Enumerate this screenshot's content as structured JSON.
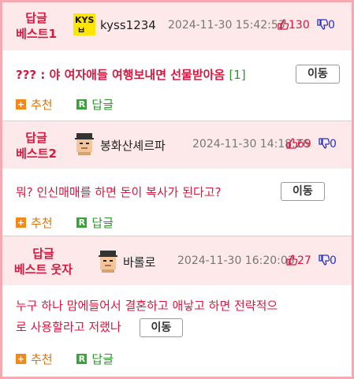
{
  "posts": [
    {
      "badge_line1": "답글",
      "badge_line2": "베스트1",
      "nickname": "kyss1234",
      "avatar_icon": "kys-logo-avatar",
      "datetime": "2024-11-30 15:42:53",
      "likes": "130",
      "dislikes": "0",
      "body": "??? : 야 여자애들 여행보내면 선물받아옴",
      "reply_count": "[1]",
      "move_label": "이동",
      "recommend_label": "추천",
      "reply_label": "답글"
    },
    {
      "badge_line1": "답글",
      "badge_line2": "베스트2",
      "nickname": "봉화산셰르파",
      "avatar_icon": "pixel-face-avatar",
      "datetime": "2024-11-30 14:18:26",
      "likes": "69",
      "dislikes": "0",
      "body": "뭐? 인신매매를 하면 돈이 복사가 된다고?",
      "move_label": "이동",
      "recommend_label": "추천",
      "reply_label": "답글"
    },
    {
      "badge_line1": "답글",
      "badge_line2": "베스트 웃자",
      "nickname": "바롤로",
      "avatar_icon": "pixel-face-avatar",
      "datetime": "2024-11-30 16:20:03",
      "likes": "27",
      "dislikes": "0",
      "body_line1": "누구 하나 맘에들어서 결혼하고 애낳고 하면 전략적으",
      "body_line2": "로 사용할라고 저랬나",
      "move_label": "이동",
      "recommend_label": "추천",
      "reply_label": "답글"
    }
  ],
  "colors": {
    "accent_red": "#d9173f",
    "header_bg": "#fde8ea",
    "border_pink": "#f5a9b1",
    "green": "#2a9a2a",
    "orange": "#f08a1c",
    "blue": "#2233cc"
  }
}
